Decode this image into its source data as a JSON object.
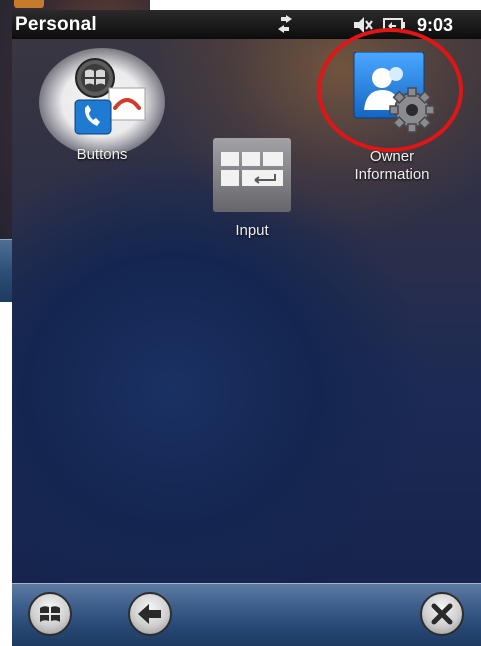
{
  "title_bar": {
    "title": "Personal",
    "time": "9:03",
    "status_icons": [
      "connectivity-icon",
      "volume-muted-icon",
      "battery-icon"
    ]
  },
  "apps": [
    {
      "label": "Buttons",
      "icon": "buttons-icon",
      "selected": true
    },
    {
      "label": "Input",
      "icon": "input-icon"
    },
    {
      "label": "Owner\nInformation",
      "icon": "owner-information-icon",
      "highlighted": true
    }
  ],
  "dock": {
    "buttons": [
      "windows-start-icon",
      "back-arrow-icon",
      "close-icon"
    ]
  },
  "colors": {
    "highlight_ring": "#e01515",
    "title_bar": "#111111",
    "dock": "#3e5f8c"
  }
}
